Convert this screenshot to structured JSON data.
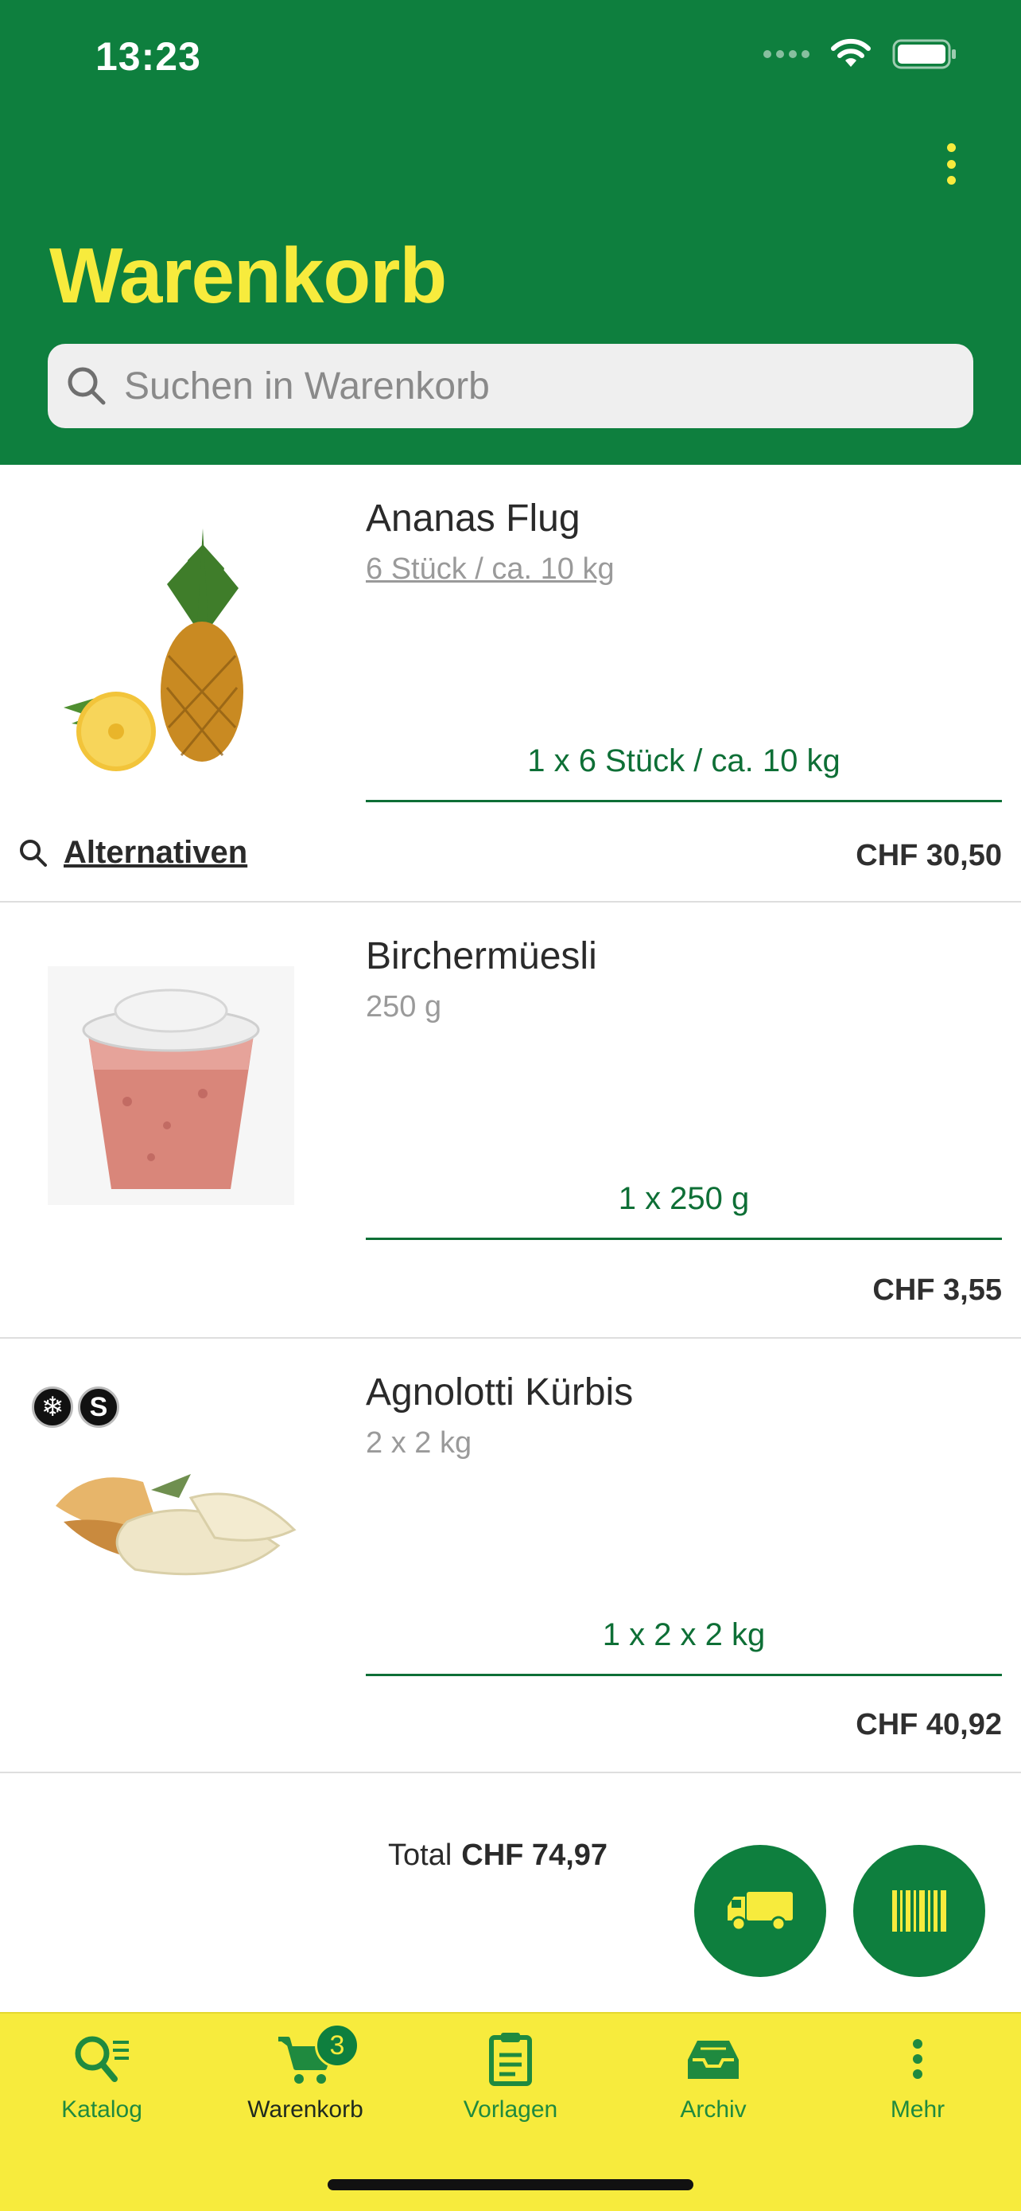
{
  "status_bar": {
    "time": "13:23"
  },
  "header": {
    "title": "Warenkorb"
  },
  "search": {
    "placeholder": "Suchen in Warenkorb"
  },
  "items": [
    {
      "name": "Ananas Flug",
      "unit": "6 Stück / ca. 10 kg",
      "quantity": "1 x 6 Stück / ca. 10 kg",
      "alternatives_label": "Alternativen",
      "price": "CHF 30,50"
    },
    {
      "name": "Birchermüesli",
      "unit": "250 g",
      "quantity": "1 x 250 g",
      "price": "CHF 3,55"
    },
    {
      "name": "Agnolotti Kürbis",
      "unit": "2 x 2 kg",
      "quantity": "1 x 2 x 2 kg",
      "price": "CHF 40,92",
      "badges": [
        "❄",
        "S"
      ]
    }
  ],
  "summary": {
    "total_label": "Total",
    "total_value": "CHF 74,97"
  },
  "tabbar": {
    "items": [
      {
        "label": "Katalog"
      },
      {
        "label": "Warenkorb",
        "badge": "3"
      },
      {
        "label": "Vorlagen"
      },
      {
        "label": "Archiv"
      },
      {
        "label": "Mehr"
      }
    ]
  },
  "colors": {
    "primary_green": "#0e7f3e",
    "accent_yellow": "#f7eb3d"
  }
}
